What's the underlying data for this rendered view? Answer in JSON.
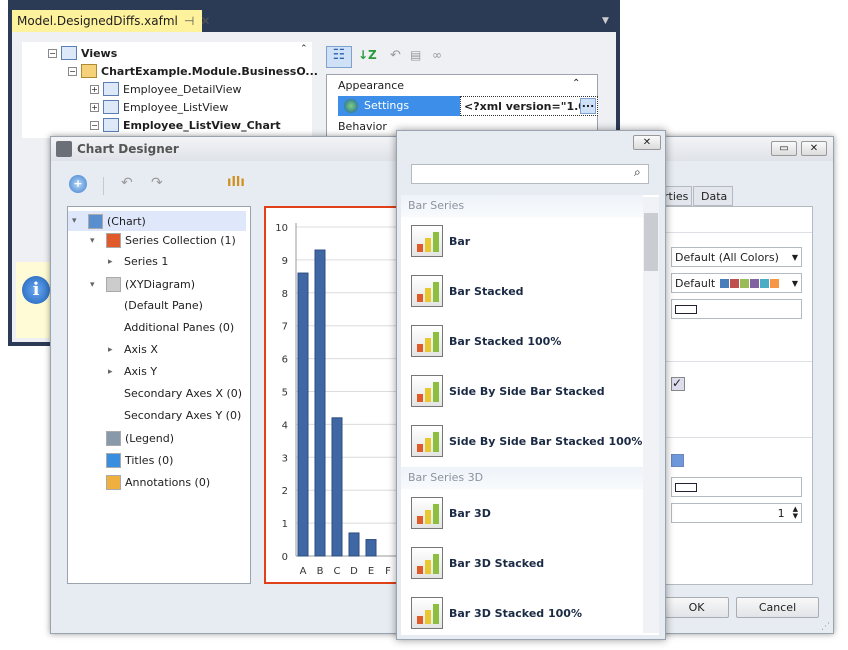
{
  "vs": {
    "tab_title": "Model.DesignedDiffs.xafml",
    "tree": [
      {
        "label": "Views",
        "bold": true
      },
      {
        "label": "ChartExample.Module.BusinessO...",
        "bold": true
      },
      {
        "label": "Employee_DetailView",
        "bold": false
      },
      {
        "label": "Employee_ListView",
        "bold": false
      },
      {
        "label": "Employee_ListView_Chart",
        "bold": true
      }
    ],
    "props": {
      "category1": "Appearance",
      "row_name": "Settings",
      "row_value": "<?xml version=\"1.0",
      "ellipsis": "...",
      "category2": "Behavior"
    }
  },
  "designer": {
    "title": "Chart Designer",
    "tree": [
      "(Chart)",
      "Series Collection (1)",
      "Series 1",
      "(XYDiagram)",
      "(Default Pane)",
      "Additional Panes (0)",
      "Axis X",
      "Axis Y",
      "Secondary Axes X (0)",
      "Secondary Axes Y (0)",
      "(Legend)",
      "Titles (0)",
      "Annotations (0)"
    ],
    "tabs": [
      "rties",
      "Data"
    ],
    "fields": {
      "palette": "Default (All Colors)",
      "palette2": "Default",
      "spin_value": "1"
    },
    "palette_colors": [
      "#4a7ebb",
      "#c0504d",
      "#9bbb59",
      "#8064a2",
      "#4bacc6",
      "#f79646"
    ],
    "ok": "OK",
    "cancel": "Cancel"
  },
  "popup": {
    "close": "✕",
    "search_placeholder": "",
    "groups": [
      {
        "label": "Bar Series",
        "items": [
          "Bar",
          "Bar Stacked",
          "Bar Stacked 100%",
          "Side By Side Bar Stacked",
          "Side By Side Bar Stacked 100%"
        ]
      },
      {
        "label": "Bar Series 3D",
        "items": [
          "Bar 3D",
          "Bar 3D Stacked",
          "Bar 3D Stacked 100%"
        ]
      }
    ]
  },
  "chart_data": {
    "type": "bar",
    "categories": [
      "A",
      "B",
      "C",
      "D",
      "E",
      "F"
    ],
    "values": [
      8.6,
      9.3,
      4.2,
      0.7,
      0.5,
      0
    ],
    "ylim": [
      0,
      10
    ],
    "yticks": [
      "0",
      "1",
      "2",
      "3",
      "4",
      "5",
      "6",
      "7",
      "8",
      "9",
      "10"
    ],
    "grid": true,
    "color": "#3f67a3"
  }
}
